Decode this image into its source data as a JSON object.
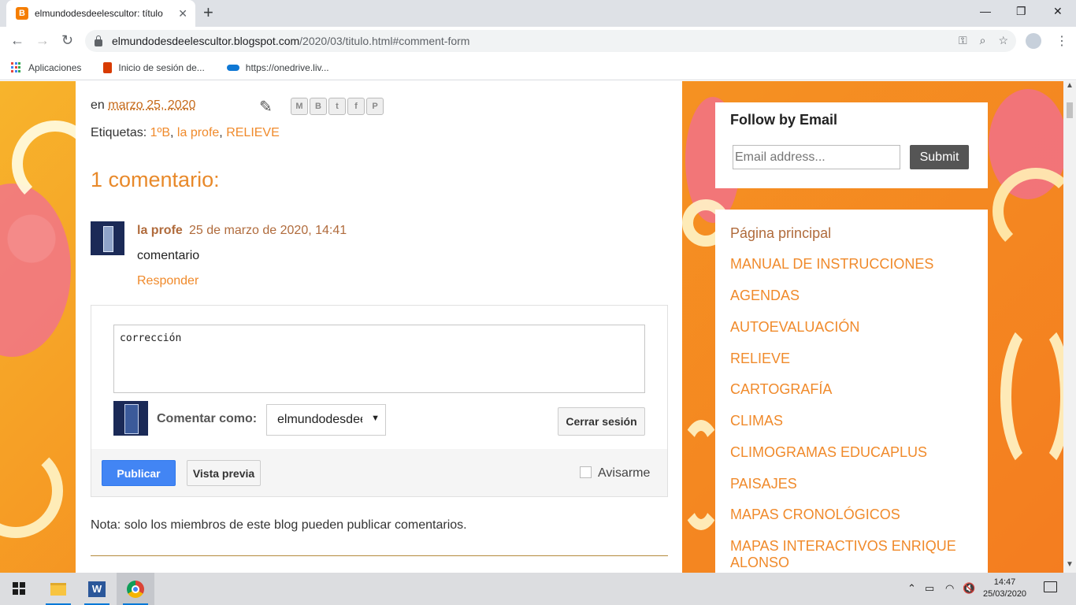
{
  "browser": {
    "tab_title": "elmundodesdeelescultor: título",
    "tab_favicon": "B",
    "tab_close": "✕",
    "new_tab": "+",
    "url_host": "elmundodesdeelescultor.blogspot.com",
    "url_path": "/2020/03/titulo.html#comment-form",
    "bookmarks": [
      "Aplicaciones",
      "Inicio de sesión de...",
      "https://onedrive.liv..."
    ]
  },
  "post": {
    "meta_prefix": "en ",
    "date": "marzo 25, 2020",
    "labels_prefix": "Etiquetas: ",
    "labels": [
      "1ºB",
      "la profe",
      "RELIEVE"
    ],
    "share_buttons": [
      "M",
      "B",
      "t",
      "f",
      "P"
    ]
  },
  "comments": {
    "title": "1 comentario:",
    "items": [
      {
        "author": "la profe",
        "date": "25 de marzo de 2020, 14:41",
        "body": "comentario",
        "reply": "Responder"
      }
    ]
  },
  "comment_form": {
    "text": "corrección",
    "comment_as_label": "Comentar como:",
    "comment_as_value": "elmundodesdeelescultor",
    "logout": "Cerrar sesión",
    "publish": "Publicar",
    "preview": "Vista previa",
    "notify": "Avisarme"
  },
  "note": "Nota: solo los miembros de este blog pueden publicar comentarios.",
  "sidebar": {
    "follow_title": "Follow by Email",
    "email_placeholder": "Email address...",
    "submit": "Submit",
    "pages": [
      "Página principal",
      "MANUAL DE INSTRUCCIONES",
      "AGENDAS",
      "AUTOEVALUACIÓN",
      "RELIEVE",
      "CARTOGRAFÍA",
      "CLIMAS",
      "CLIMOGRAMAS EDUCAPLUS",
      "PAISAJES",
      "MAPAS CRONOLÓGICOS",
      "MAPAS INTERACTIVOS ENRIQUE ALONSO"
    ]
  },
  "taskbar": {
    "time": "14:47",
    "date": "25/03/2020",
    "word_letter": "W"
  },
  "colors": {
    "link_orange": "#f08a2b",
    "author_brown": "#b06b3c",
    "publish_blue": "#4285f4"
  }
}
